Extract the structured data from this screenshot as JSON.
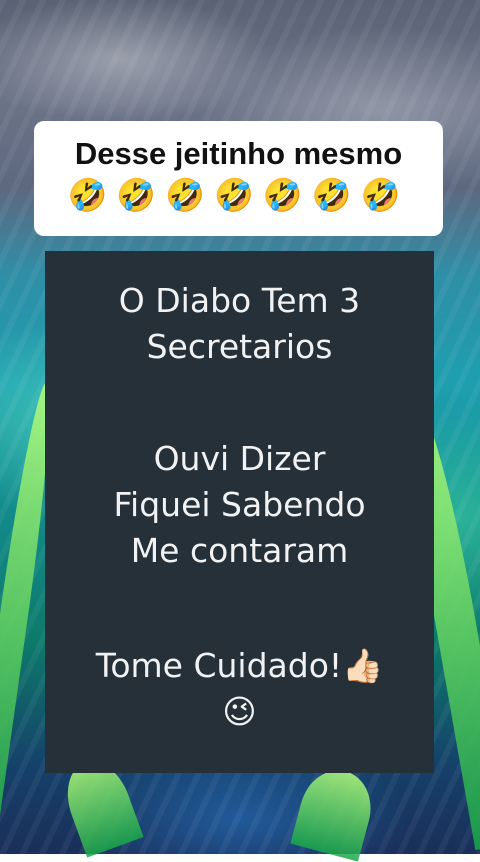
{
  "caption": {
    "title": "Desse jeitinho mesmo",
    "emojis": "🤣🤣🤣🤣🤣🤣🤣"
  },
  "panel": {
    "lines_block1": [
      "O Diabo Tem 3",
      "Secretarios"
    ],
    "lines_block2": [
      "Ouvi Dizer",
      "Fiquei Sabendo",
      "Me contaram"
    ],
    "lines_block3": [
      "Tome Cuidado!👍🏻",
      "😉"
    ]
  },
  "colors": {
    "panel_bg": "#253039",
    "panel_text": "#f2f2f2",
    "caption_bg": "#ffffff",
    "caption_text": "#111111"
  }
}
